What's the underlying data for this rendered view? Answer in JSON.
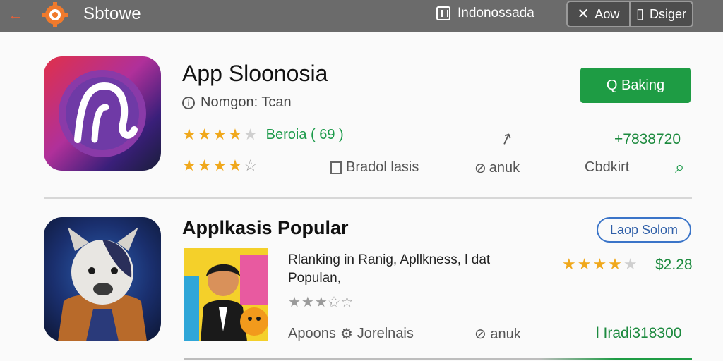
{
  "header": {
    "back_icon": "back-arrow-icon",
    "logo_icon": "gear-logo-icon",
    "title": "Sbtowe",
    "region_label": "Indonossada",
    "button_a_label": "Aow",
    "button_b_label": "Dsiger"
  },
  "featured": {
    "app_name": "App Sloonosia",
    "developer": "Nomgon: Tcan",
    "rating_label": "Beroia ( 69 )",
    "install_label": "Q Baking",
    "price": "+7838720",
    "meta_1": "Bradol lasis",
    "meta_2": "anuk",
    "meta_3": "Cbdkirt",
    "accent_color": "#1e9c44"
  },
  "popular": {
    "section_title": "Applkasis Popular",
    "outline_button_label": "Laop Solom",
    "description": "Rlanking in Ranig, Apllkness, l dat Populan,",
    "price": "$2.28",
    "meta_1": "Apoons",
    "meta_2": "Jorelnais",
    "meta_3": "anuk",
    "price_bottom": "l Iradi318300",
    "link_color": "#3a74c8"
  }
}
